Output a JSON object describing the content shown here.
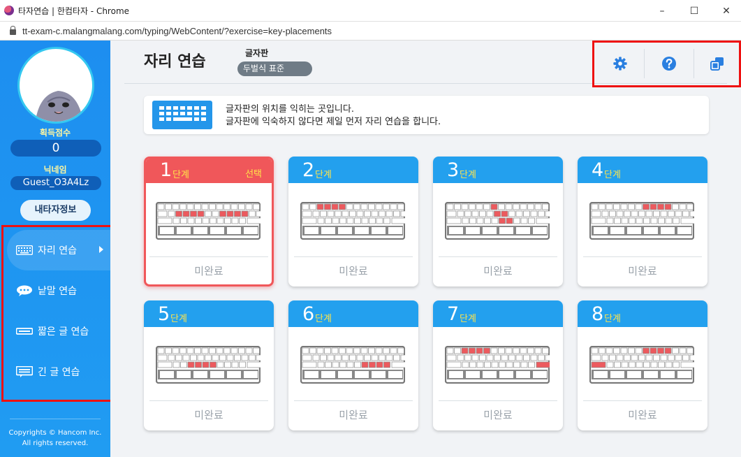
{
  "window": {
    "title": "타자연습 | 한컴타자 - Chrome",
    "url": "tt-exam-c.malangmalang.com/typing/WebContent/?exercise=key-placements",
    "minimize_glyph": "–",
    "maximize_glyph": "☐",
    "close_glyph": "✕"
  },
  "sidebar": {
    "score_label": "획득점수",
    "score_value": "0",
    "nickname_label": "닉네임",
    "nickname_value": "Guest_O3A4Lz",
    "profile_button": "내타자정보",
    "menu": [
      {
        "label": "자리 연습",
        "icon": "keyboard-icon",
        "active": true
      },
      {
        "label": "낱말 연습",
        "icon": "speech-bubble-icon",
        "active": false
      },
      {
        "label": "짧은 글 연습",
        "icon": "short-text-icon",
        "active": false
      },
      {
        "label": "긴 글 연습",
        "icon": "long-text-icon",
        "active": false
      }
    ],
    "copyright_line1": "Copyrights © Hancom Inc.",
    "copyright_line2": "All rights reserved."
  },
  "header": {
    "title": "자리 연습",
    "keyboard_label": "글자판",
    "keyboard_layout": "두벌식 표준",
    "tools": [
      "gear-icon",
      "help-icon",
      "window-icon"
    ]
  },
  "info": {
    "line1": "글자판의 위치를 익히는 곳입니다.",
    "line2": "글자판에 익숙하지 않다면 제일 먼저 자리 연습을 합니다."
  },
  "colors": {
    "accent_blue": "#23a0ee",
    "selected_red": "#f0575a",
    "highlight_key": "#ec5a5e",
    "sidebar_blue": "#1d8ef0"
  },
  "levels": [
    {
      "num": "1",
      "unit": "단계",
      "status": "미완료",
      "selected": true,
      "selected_label": "선택",
      "highlight": "home-row"
    },
    {
      "num": "2",
      "unit": "단계",
      "status": "미완료",
      "selected": false,
      "highlight": "top-left"
    },
    {
      "num": "3",
      "unit": "단계",
      "status": "미완료",
      "selected": false,
      "highlight": "center-column"
    },
    {
      "num": "4",
      "unit": "단계",
      "status": "미완료",
      "selected": false,
      "highlight": "top-right"
    },
    {
      "num": "5",
      "unit": "단계",
      "status": "미완료",
      "selected": false,
      "highlight": "bottom-left"
    },
    {
      "num": "6",
      "unit": "단계",
      "status": "미완료",
      "selected": false,
      "highlight": "bottom-right"
    },
    {
      "num": "7",
      "unit": "단계",
      "status": "미완료",
      "selected": false,
      "highlight": "top-left-plus-enter"
    },
    {
      "num": "8",
      "unit": "단계",
      "status": "미완료",
      "selected": false,
      "highlight": "top-right-plus-shift"
    }
  ]
}
